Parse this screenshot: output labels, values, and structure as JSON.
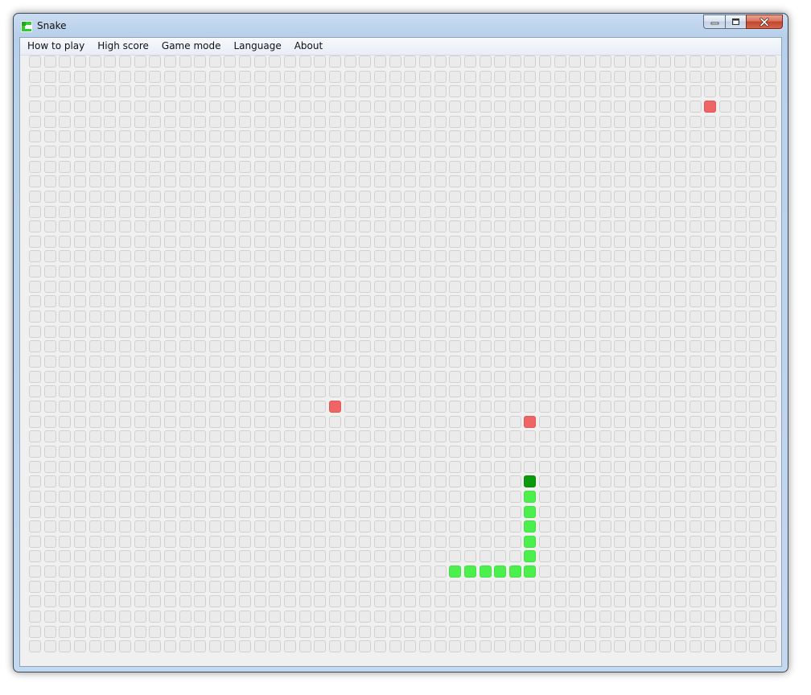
{
  "window": {
    "title": "Snake"
  },
  "menu": [
    {
      "id": "how-to-play",
      "label": "How to play"
    },
    {
      "id": "high-score",
      "label": "High score"
    },
    {
      "id": "game-mode",
      "label": "Game mode"
    },
    {
      "id": "language",
      "label": "Language"
    },
    {
      "id": "about",
      "label": "About"
    }
  ],
  "colors": {
    "empty_cell": "#ebebeb",
    "food": "#ef6464",
    "snake_body": "#4cf04c",
    "snake_head": "#0c9a0c"
  },
  "game": {
    "grid_cols": 50,
    "grid_rows": 40,
    "food": [
      {
        "col": 45,
        "row": 3
      },
      {
        "col": 20,
        "row": 23
      },
      {
        "col": 33,
        "row": 24
      }
    ],
    "snake": [
      {
        "col": 33,
        "row": 28
      },
      {
        "col": 33,
        "row": 29
      },
      {
        "col": 33,
        "row": 30
      },
      {
        "col": 33,
        "row": 31
      },
      {
        "col": 33,
        "row": 32
      },
      {
        "col": 33,
        "row": 33
      },
      {
        "col": 33,
        "row": 34
      },
      {
        "col": 32,
        "row": 34
      },
      {
        "col": 31,
        "row": 34
      },
      {
        "col": 30,
        "row": 34
      },
      {
        "col": 29,
        "row": 34
      },
      {
        "col": 28,
        "row": 34
      }
    ]
  }
}
